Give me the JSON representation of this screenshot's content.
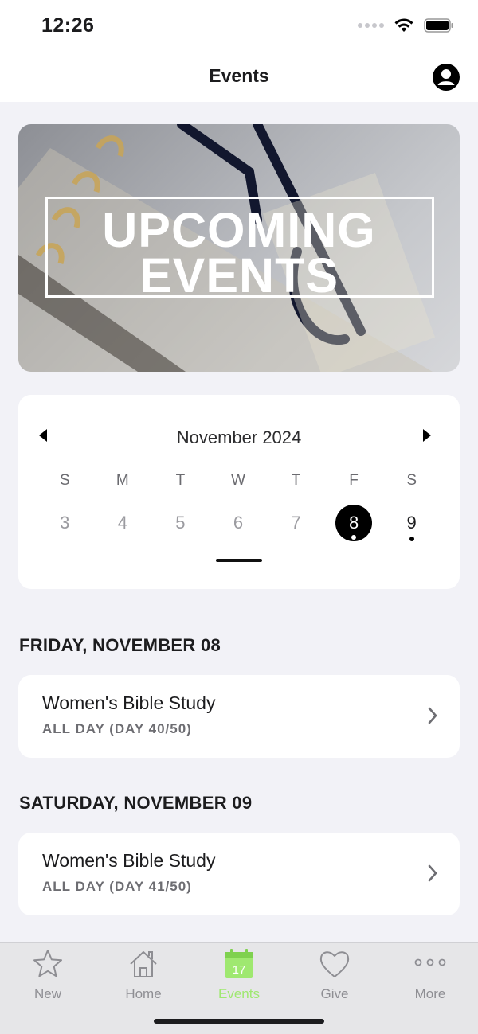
{
  "status_bar": {
    "time": "12:26"
  },
  "nav": {
    "title": "Events",
    "profile_icon": "user-circle-icon"
  },
  "banner": {
    "line1": "UPCOMING",
    "line2": "EVENTS"
  },
  "calendar": {
    "month": "November 2024",
    "weekdays": [
      "S",
      "M",
      "T",
      "W",
      "T",
      "F",
      "S"
    ],
    "days": [
      "3",
      "4",
      "5",
      "6",
      "7",
      "8",
      "9"
    ],
    "selected_day": "8"
  },
  "events": [
    {
      "date_header": "FRIDAY, NOVEMBER 08",
      "title": "Women's Bible Study",
      "subtitle": "ALL DAY (DAY 40/50)"
    },
    {
      "date_header": "SATURDAY, NOVEMBER 09",
      "title": "Women's Bible Study",
      "subtitle": "ALL DAY (DAY 41/50)"
    }
  ],
  "tabs": [
    {
      "label": "New",
      "icon": "star-icon"
    },
    {
      "label": "Home",
      "icon": "home-icon"
    },
    {
      "label": "Events",
      "icon": "calendar-icon",
      "icon_text": "17",
      "active": true
    },
    {
      "label": "Give",
      "icon": "heart-icon"
    },
    {
      "label": "More",
      "icon": "more-icon"
    }
  ],
  "colors": {
    "accent": "#9fe870",
    "background": "#f2f2f7",
    "card": "#ffffff"
  }
}
